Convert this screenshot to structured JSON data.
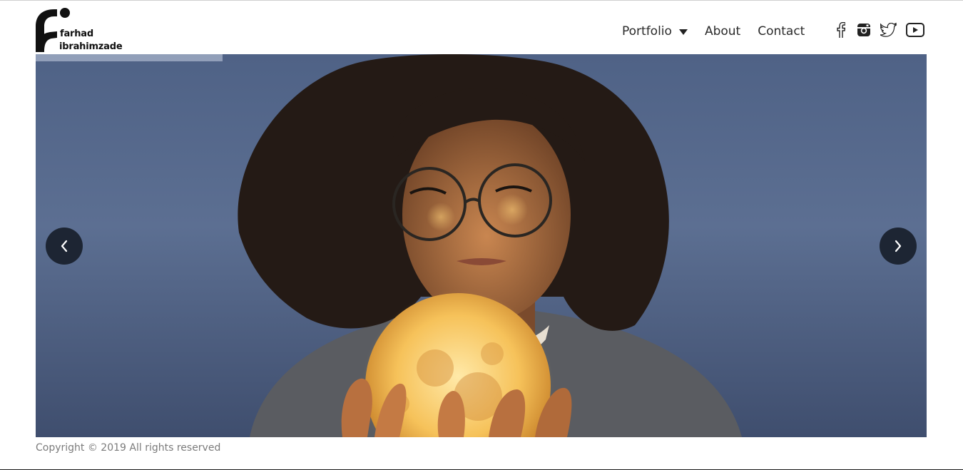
{
  "brand": {
    "name_line1": "farhad",
    "name_line2": "ibrahimzade"
  },
  "nav": {
    "items": [
      {
        "label": "Portfolio",
        "has_dropdown": true
      },
      {
        "label": "About"
      },
      {
        "label": "Contact"
      }
    ]
  },
  "socials": [
    "facebook-icon",
    "instagram-icon",
    "twitter-icon",
    "youtube-icon"
  ],
  "slider": {
    "prev_icon": "chevron-left-icon",
    "next_icon": "chevron-right-icon",
    "progress": 0.21,
    "image_subject": "woman with glasses holding glowing moon"
  },
  "footer": {
    "copyright": "Copyright © 2019 All rights reserved"
  },
  "colors": {
    "arrow_bg": "#1d2533",
    "text_dark": "#2a2a2a",
    "footer_text": "#7b7b7b"
  }
}
